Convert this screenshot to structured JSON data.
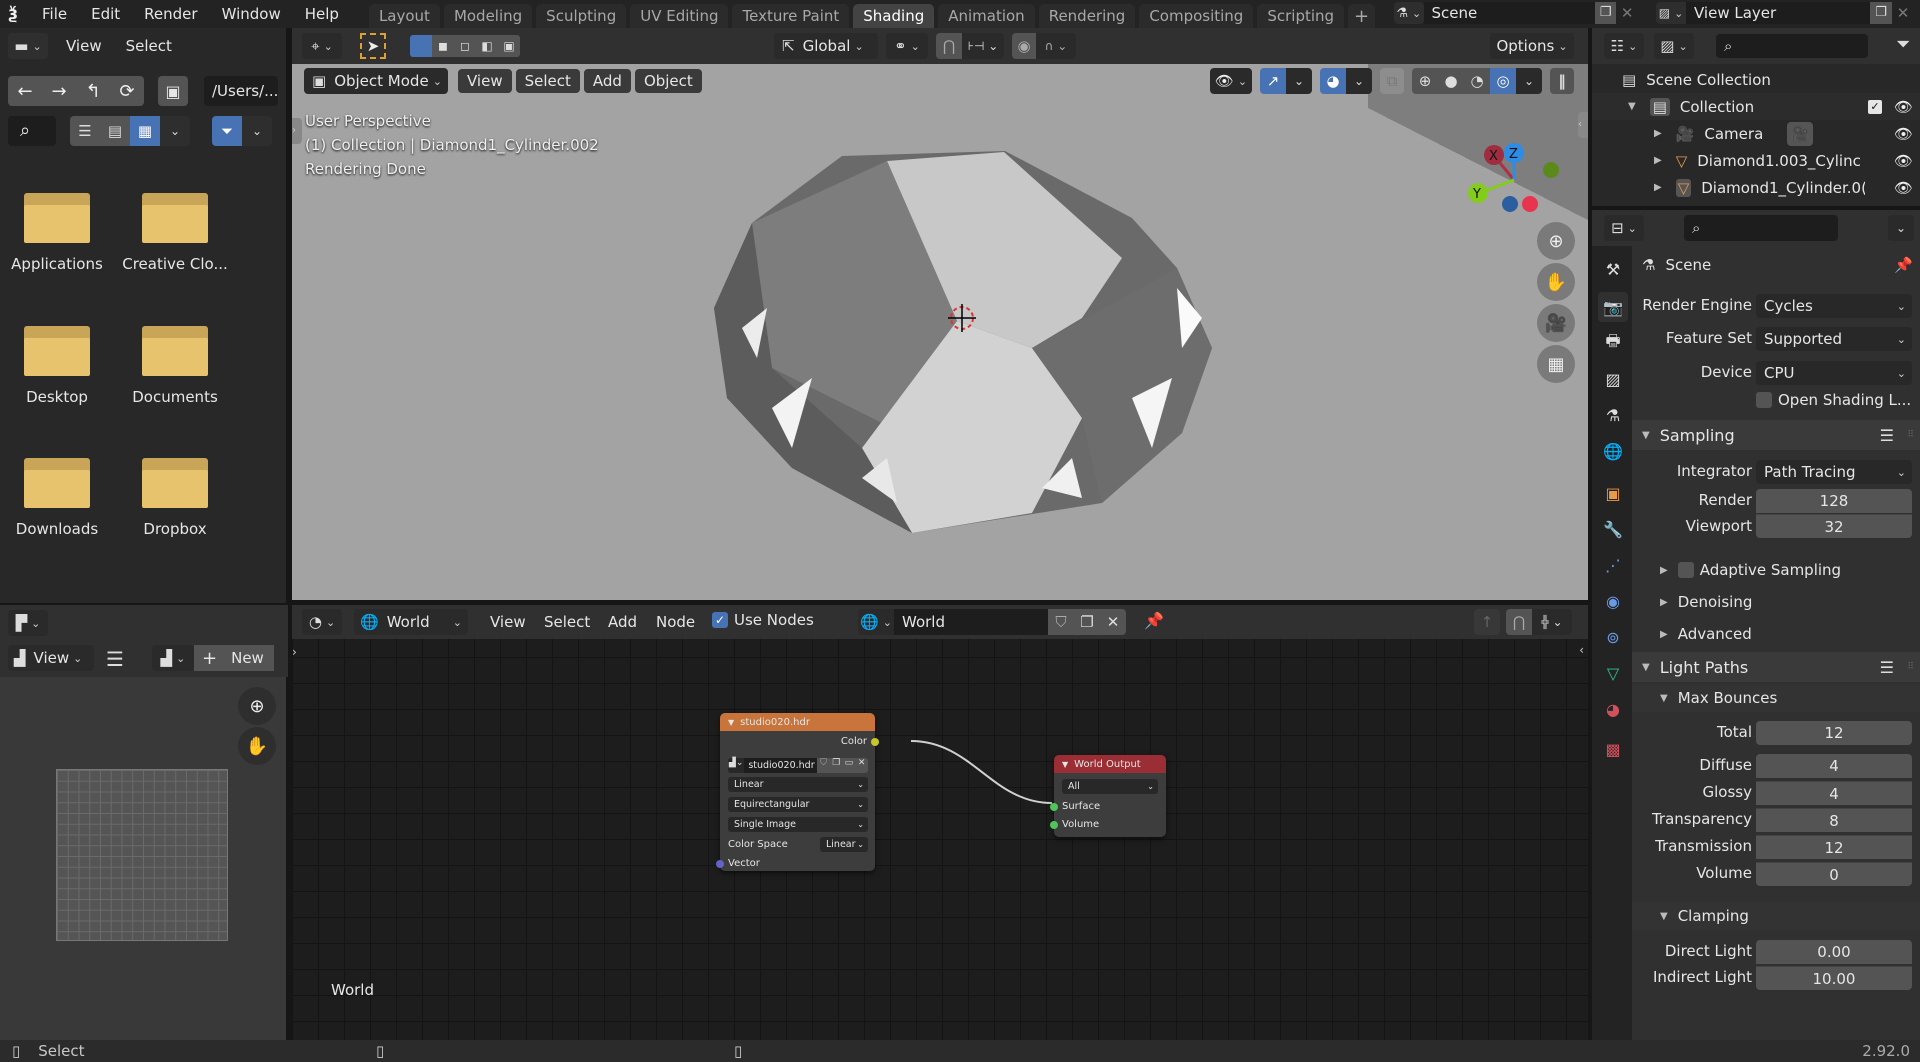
{
  "app": {
    "menu": [
      "File",
      "Edit",
      "Render",
      "Window",
      "Help"
    ],
    "workspace_tabs": [
      "Layout",
      "Modeling",
      "Sculpting",
      "UV Editing",
      "Texture Paint",
      "Shading",
      "Animation",
      "Rendering",
      "Compositing",
      "Scripting"
    ],
    "active_tab": "Shading",
    "add_tab": "+",
    "scene_name": "Scene",
    "view_layer": "View Layer",
    "version": "2.92.0"
  },
  "file_browser": {
    "menu": [
      "View",
      "Select"
    ],
    "path": "/Users/...",
    "nav_icons": [
      "arrow-left-icon",
      "arrow-right-icon",
      "parent-dir-icon",
      "refresh-icon",
      "new-folder-icon"
    ],
    "folders": [
      {
        "name": "Applications",
        "icon": "folder-icon"
      },
      {
        "name": "Creative Clo...",
        "icon": "folder-icon"
      },
      {
        "name": "Desktop",
        "icon": "folder-desktop-icon"
      },
      {
        "name": "Documents",
        "icon": "folder-documents-icon"
      },
      {
        "name": "Downloads",
        "icon": "folder-download-icon"
      },
      {
        "name": "Dropbox",
        "icon": "folder-icon"
      }
    ]
  },
  "image_editor": {
    "view_label": "View",
    "new_label": "New"
  },
  "viewport": {
    "mode": "Object Mode",
    "menu": [
      "View",
      "Select",
      "Add",
      "Object"
    ],
    "transform_orientation": "Global",
    "options_label": "Options",
    "overlay_lines": [
      "User Perspective",
      "(1) Collection | Diamond1_Cylinder.002",
      "Rendering Done"
    ],
    "gizmo_axes": {
      "x": "X",
      "y": "Y",
      "z": "Z"
    },
    "colors": {
      "x": "#d0344e",
      "y": "#84cc1c",
      "z": "#2d8ce6"
    }
  },
  "node_editor": {
    "type": "World",
    "menu": [
      "View",
      "Select",
      "Add",
      "Node"
    ],
    "use_nodes_label": "Use Nodes",
    "use_nodes": true,
    "world_name": "World",
    "corner_label": "World",
    "nodes": {
      "env_texture": {
        "title": "studio020.hdr",
        "output": "Color",
        "image": "studio020.hdr",
        "interpolation": "Linear",
        "projection": "Equirectangular",
        "source": "Single Image",
        "color_space_label": "Color Space",
        "color_space": "Linear",
        "input": "Vector"
      },
      "world_output": {
        "title": "World Output",
        "target": "All",
        "inputs": [
          "Surface",
          "Volume"
        ]
      }
    }
  },
  "outliner": {
    "rows": [
      {
        "label": "Scene Collection",
        "icon": "scene-collection-icon"
      },
      {
        "label": "Collection",
        "icon": "collection-icon"
      },
      {
        "label": "Camera",
        "icon": "camera-icon"
      },
      {
        "label": "Diamond1.003_Cylinc",
        "icon": "mesh-icon"
      },
      {
        "label": "Diamond1_Cylinder.0(",
        "icon": "mesh-icon"
      }
    ]
  },
  "properties": {
    "context": "Scene",
    "render_engine_label": "Render Engine",
    "render_engine": "Cycles",
    "feature_set_label": "Feature Set",
    "feature_set": "Supported",
    "device_label": "Device",
    "device": "CPU",
    "osl_label": "Open Shading L...",
    "sampling": {
      "title": "Sampling",
      "integrator_label": "Integrator",
      "integrator": "Path Tracing",
      "render_label": "Render",
      "render": "128",
      "viewport_label": "Viewport",
      "viewport": "32",
      "adaptive_label": "Adaptive Sampling",
      "denoising_label": "Denoising",
      "advanced_label": "Advanced"
    },
    "light_paths": {
      "title": "Light Paths",
      "max_bounces_label": "Max Bounces",
      "fields": [
        {
          "label": "Total",
          "value": "12"
        },
        {
          "label": "Diffuse",
          "value": "4"
        },
        {
          "label": "Glossy",
          "value": "4"
        },
        {
          "label": "Transparency",
          "value": "8"
        },
        {
          "label": "Transmission",
          "value": "12"
        },
        {
          "label": "Volume",
          "value": "0"
        }
      ],
      "clamping_label": "Clamping",
      "direct_light_label": "Direct Light",
      "direct_light": "0.00",
      "indirect_light_label": "Indirect Light",
      "indirect_light": "10.00"
    }
  },
  "status_bar": {
    "left_action": "Select"
  }
}
